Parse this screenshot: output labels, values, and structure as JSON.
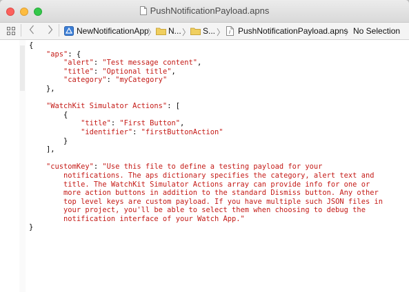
{
  "window": {
    "title": "PushNotificationPayload.apns"
  },
  "jumpbar": {
    "project": "NewNotificationApp",
    "folder1": "N...",
    "folder2": "S...",
    "file": "PushNotificationPayload.apns",
    "selection": "No Selection"
  },
  "code_lines": [
    [
      {
        "t": "{",
        "c": "p"
      }
    ],
    [
      {
        "t": "    ",
        "c": "p"
      },
      {
        "t": "\"aps\"",
        "c": "s"
      },
      {
        "t": ": {",
        "c": "p"
      }
    ],
    [
      {
        "t": "        ",
        "c": "p"
      },
      {
        "t": "\"alert\"",
        "c": "s"
      },
      {
        "t": ": ",
        "c": "p"
      },
      {
        "t": "\"Test message content\"",
        "c": "s"
      },
      {
        "t": ",",
        "c": "p"
      }
    ],
    [
      {
        "t": "        ",
        "c": "p"
      },
      {
        "t": "\"title\"",
        "c": "s"
      },
      {
        "t": ": ",
        "c": "p"
      },
      {
        "t": "\"Optional title\"",
        "c": "s"
      },
      {
        "t": ",",
        "c": "p"
      }
    ],
    [
      {
        "t": "        ",
        "c": "p"
      },
      {
        "t": "\"category\"",
        "c": "s"
      },
      {
        "t": ": ",
        "c": "p"
      },
      {
        "t": "\"myCategory\"",
        "c": "s"
      }
    ],
    [
      {
        "t": "    },",
        "c": "p"
      }
    ],
    [
      {
        "t": "",
        "c": "p"
      }
    ],
    [
      {
        "t": "    ",
        "c": "p"
      },
      {
        "t": "\"WatchKit Simulator Actions\"",
        "c": "s"
      },
      {
        "t": ": [",
        "c": "p"
      }
    ],
    [
      {
        "t": "        {",
        "c": "p"
      }
    ],
    [
      {
        "t": "            ",
        "c": "p"
      },
      {
        "t": "\"title\"",
        "c": "s"
      },
      {
        "t": ": ",
        "c": "p"
      },
      {
        "t": "\"First Button\"",
        "c": "s"
      },
      {
        "t": ",",
        "c": "p"
      }
    ],
    [
      {
        "t": "            ",
        "c": "p"
      },
      {
        "t": "\"identifier\"",
        "c": "s"
      },
      {
        "t": ": ",
        "c": "p"
      },
      {
        "t": "\"firstButtonAction\"",
        "c": "s"
      }
    ],
    [
      {
        "t": "        }",
        "c": "p"
      }
    ],
    [
      {
        "t": "    ],",
        "c": "p"
      }
    ],
    [
      {
        "t": "",
        "c": "p"
      }
    ],
    [
      {
        "t": "    ",
        "c": "p"
      },
      {
        "t": "\"customKey\"",
        "c": "s"
      },
      {
        "t": ": ",
        "c": "p"
      },
      {
        "t": "\"Use this file to define a testing payload for your",
        "c": "s"
      }
    ],
    [
      {
        "t": "        notifications. The aps dictionary specifies the category, alert text and",
        "c": "s"
      }
    ],
    [
      {
        "t": "        title. The WatchKit Simulator Actions array can provide info for one or",
        "c": "s"
      }
    ],
    [
      {
        "t": "        more action buttons in addition to the standard Dismiss button. Any other",
        "c": "s"
      }
    ],
    [
      {
        "t": "        top level keys are custom payload. If you have multiple such JSON files in",
        "c": "s"
      }
    ],
    [
      {
        "t": "        your project, you'll be able to select them when choosing to debug the",
        "c": "s"
      }
    ],
    [
      {
        "t": "        notification interface of your Watch App.\"",
        "c": "s"
      }
    ],
    [
      {
        "t": "}",
        "c": "p"
      }
    ]
  ]
}
